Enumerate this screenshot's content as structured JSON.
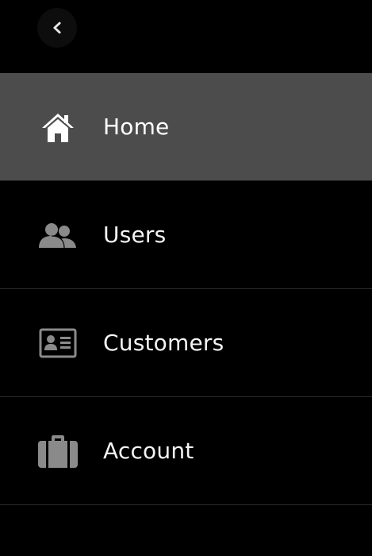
{
  "header": {
    "back_icon": "chevron-left-icon"
  },
  "colors": {
    "background": "#000000",
    "active_item": "#4c4c4c",
    "icon_inactive": "#8a8a8a",
    "icon_active": "#ffffff",
    "divider": "#2a2a2a",
    "text": "#ffffff"
  },
  "nav": {
    "items": [
      {
        "label": "Home",
        "icon": "home-icon",
        "active": true
      },
      {
        "label": "Users",
        "icon": "users-icon",
        "active": false
      },
      {
        "label": "Customers",
        "icon": "id-card-icon",
        "active": false
      },
      {
        "label": "Account",
        "icon": "briefcase-icon",
        "active": false
      }
    ]
  }
}
